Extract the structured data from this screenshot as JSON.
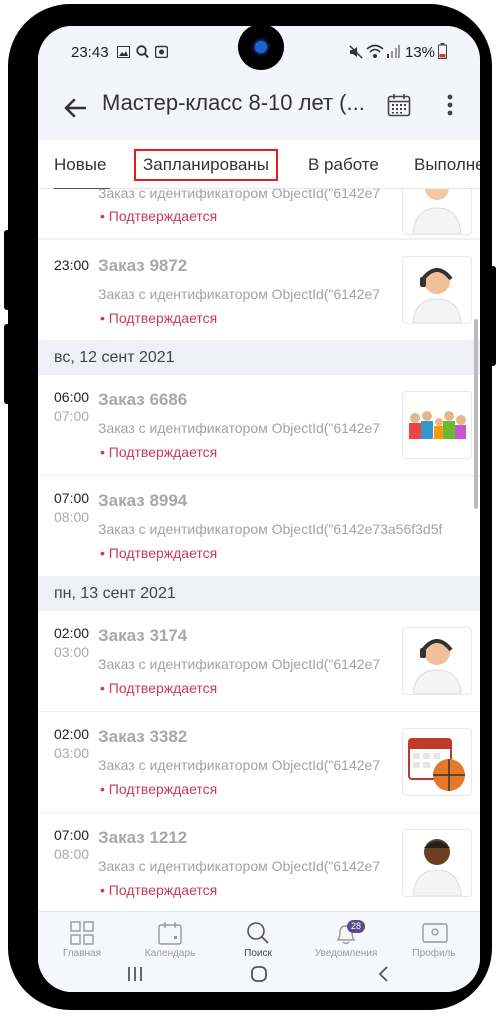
{
  "status_bar": {
    "time": "23:43",
    "battery": "13%"
  },
  "app_bar": {
    "title": "Мастер-класс 8-10 лет (..."
  },
  "tabs": [
    {
      "label": "Новые"
    },
    {
      "label": "Запланированы"
    },
    {
      "label": "В работе"
    },
    {
      "label": "Выполне"
    }
  ],
  "orders": [
    {
      "time": "",
      "end": "",
      "title": "",
      "sub": "Заказ с идентификатором ObjectId(\"6142e7",
      "status": "• Подтверждается",
      "icon": "man-avatar-icon"
    },
    {
      "time": "23:00",
      "end": "",
      "title": "Заказ 9872",
      "sub": "Заказ с идентификатором ObjectId(\"6142e7",
      "status": "• Подтверждается",
      "icon": "support-operator-icon"
    },
    {
      "time": "06:00",
      "end": "07:00",
      "title": "Заказ 6686",
      "sub": "Заказ с идентификатором ObjectId(\"6142e7",
      "status": "• Подтверждается",
      "icon": "family-group-icon"
    },
    {
      "time": "07:00",
      "end": "08:00",
      "title": "Заказ 8994",
      "sub": "Заказ с идентификатором ObjectId(\"6142e73a56f3d5f",
      "status": "• Подтверждается",
      "icon": "none"
    },
    {
      "time": "02:00",
      "end": "03:00",
      "title": "Заказ 3174",
      "sub": "Заказ с идентификатором ObjectId(\"6142e7",
      "status": "• Подтверждается",
      "icon": "support-operator-icon"
    },
    {
      "time": "02:00",
      "end": "03:00",
      "title": "Заказ 3382",
      "sub": "Заказ с идентификатором ObjectId(\"6142e7",
      "status": "• Подтверждается",
      "icon": "calendar-basketball-icon"
    },
    {
      "time": "07:00",
      "end": "08:00",
      "title": "Заказ 1212",
      "sub": "Заказ с идентификатором ObjectId(\"6142e7",
      "status": "• Подтверждается",
      "icon": "man-avatar-dark-icon"
    }
  ],
  "date_headers": [
    "вс, 12 сент 2021",
    "пн, 13 сент 2021"
  ],
  "bottom_nav": [
    {
      "label": "Главная",
      "icon": "home-grid-icon"
    },
    {
      "label": "Календарь",
      "icon": "calendar-icon"
    },
    {
      "label": "Поиск",
      "icon": "search-icon"
    },
    {
      "label": "Уведомления",
      "icon": "bell-icon",
      "badge": "28"
    },
    {
      "label": "Профиль",
      "icon": "profile-card-icon"
    }
  ],
  "colors": {
    "status": "#c9395a",
    "tab_highlight": "#e11d1d",
    "badge": "#5b4b8a"
  }
}
